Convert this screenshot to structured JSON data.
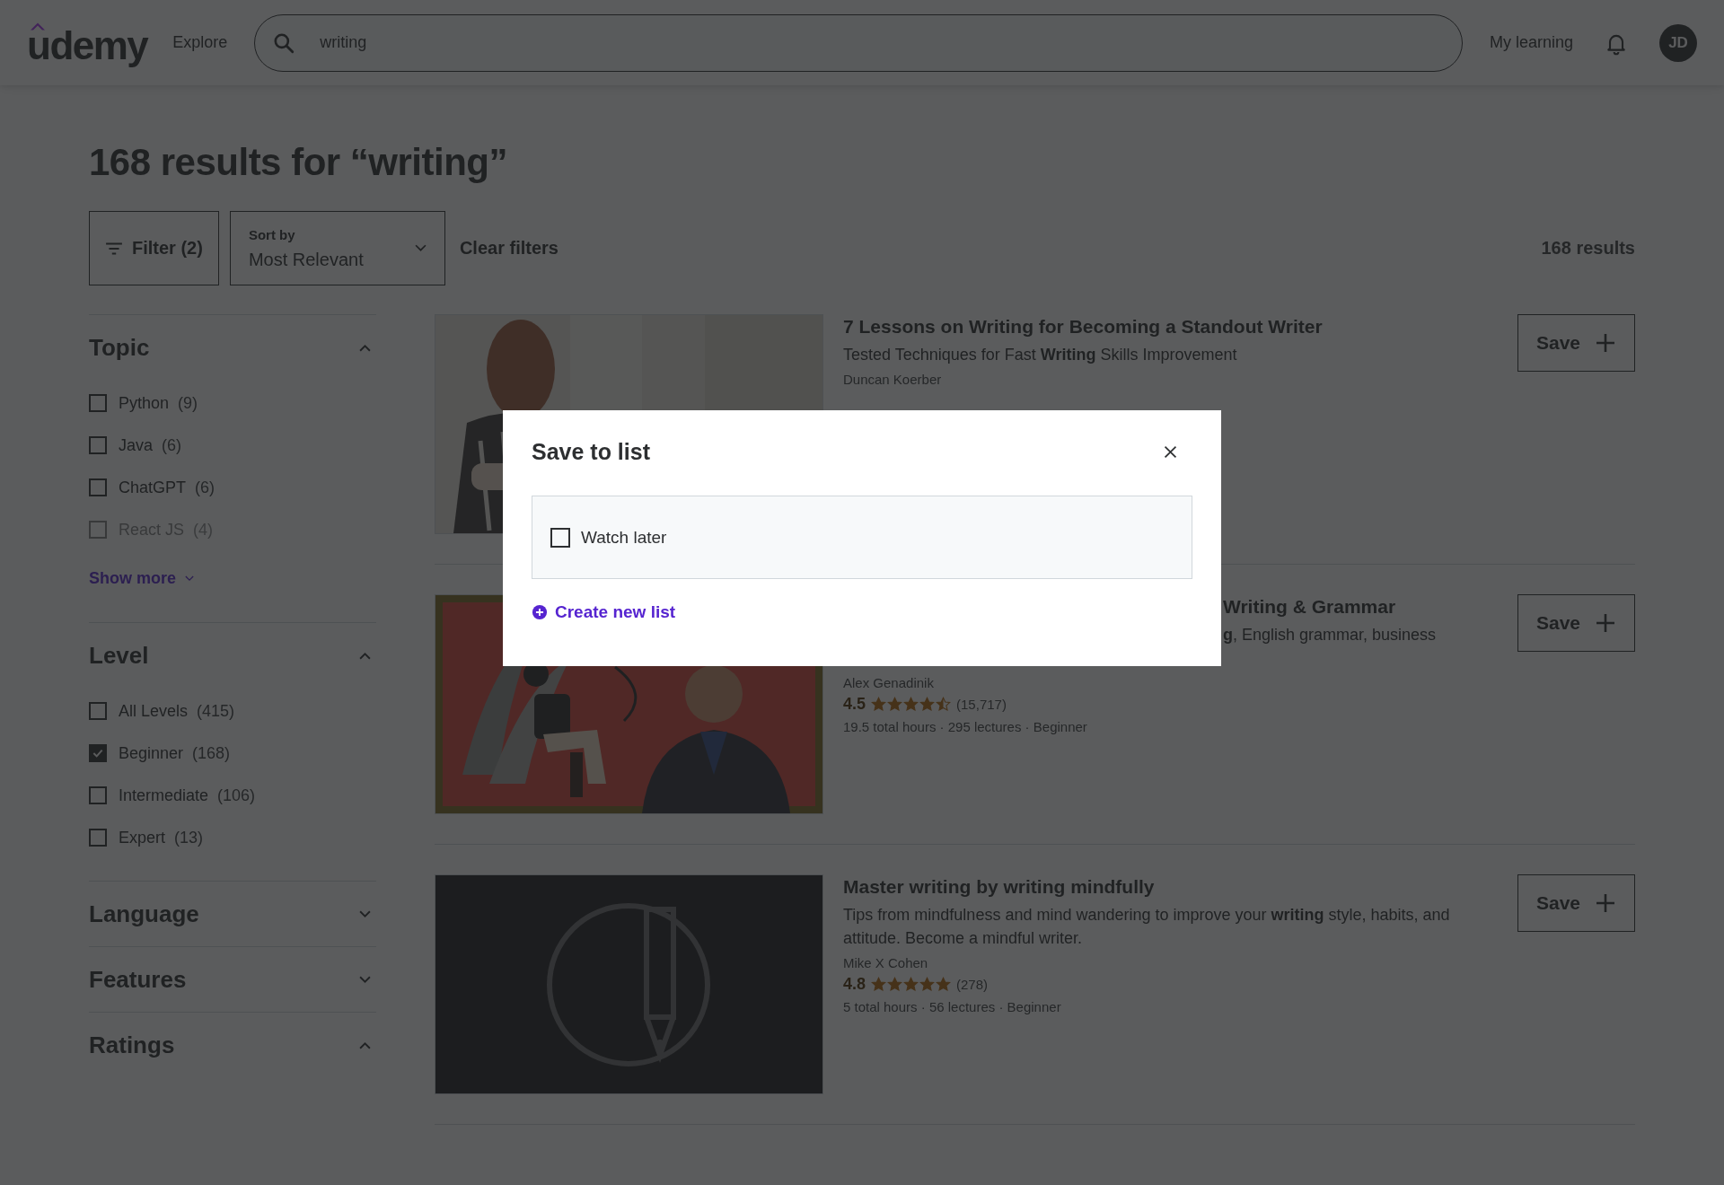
{
  "header": {
    "logo": "udemy",
    "explore": "Explore",
    "search": {
      "value": "writing"
    },
    "my_learning": "My learning",
    "avatar": "JD"
  },
  "heading": "168 results for “writing”",
  "toolbar": {
    "filter": "Filter (2)",
    "sort_label": "Sort by",
    "sort_value": "Most Relevant",
    "clear": "Clear filters",
    "count": "168 results"
  },
  "sidebar": {
    "sections": [
      {
        "title": "Topic",
        "expanded": true,
        "show_more": "Show more",
        "options": [
          {
            "label": "Python",
            "count": "(9)",
            "checked": false,
            "faded": false
          },
          {
            "label": "Java",
            "count": "(6)",
            "checked": false,
            "faded": false
          },
          {
            "label": "ChatGPT",
            "count": "(6)",
            "checked": false,
            "faded": false
          },
          {
            "label": "React JS",
            "count": "(4)",
            "checked": false,
            "faded": true
          }
        ]
      },
      {
        "title": "Level",
        "expanded": true,
        "options": [
          {
            "label": "All Levels",
            "count": "(415)",
            "checked": false,
            "faded": false
          },
          {
            "label": "Beginner",
            "count": "(168)",
            "checked": true,
            "faded": false
          },
          {
            "label": "Intermediate",
            "count": "(106)",
            "checked": false,
            "faded": false
          },
          {
            "label": "Expert",
            "count": "(13)",
            "checked": false,
            "faded": false
          }
        ]
      },
      {
        "title": "Language",
        "expanded": false
      },
      {
        "title": "Features",
        "expanded": false
      },
      {
        "title": "Ratings",
        "expanded": true
      }
    ]
  },
  "courses": [
    {
      "title": "7 Lessons on Writing for Becoming a Standout Writer",
      "subtitle": "Tested Techniques for Fast **Writing** Skills Improvement",
      "instructor": "Duncan Koerber",
      "covered": false,
      "save": "Save"
    },
    {
      "title": "Writing & Grammar",
      "subtitle": "**g**, English grammar, business",
      "instructor": "Alex Genadinik",
      "rating": "4.5",
      "stars": 4.5,
      "reviews": "(15,717)",
      "meta": "19.5 total hours · 295 lectures · Beginner",
      "covered": true,
      "save": "Save"
    },
    {
      "title": "Master writing by writing mindfully",
      "subtitle": "Tips from mindfulness and mind wandering to improve your **writing** style, habits, and attitude. Become a mindful writer.",
      "instructor": "Mike X Cohen",
      "rating": "4.8",
      "stars": 5,
      "reviews": "(278)",
      "meta": "5 total hours · 56 lectures · Beginner",
      "covered": false,
      "save": "Save"
    }
  ],
  "modal": {
    "title": "Save to list",
    "lists": [
      {
        "label": "Watch later",
        "checked": false
      }
    ],
    "create": "Create new list"
  }
}
